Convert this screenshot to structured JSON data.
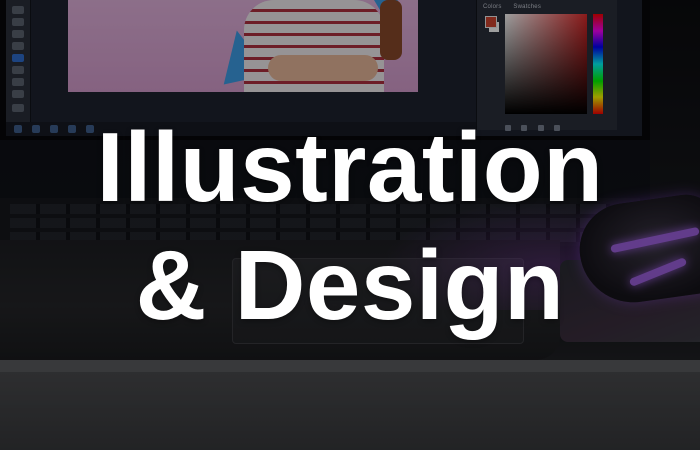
{
  "headline": {
    "line1": "Illustration",
    "line2": "& Design"
  },
  "photo": {
    "editor_panel_tabs": [
      "Colors",
      "Swatches"
    ],
    "icons": {
      "mouse": "gaming-mouse-icon",
      "monitor": "monitor-icon",
      "keyboard": "keyboard-icon"
    }
  },
  "colors": {
    "text": "#ffffff",
    "mouse_glow": "#b36cff",
    "canvas_pink": "#d7a9d3",
    "accent_blue": "#3e9ee8"
  }
}
